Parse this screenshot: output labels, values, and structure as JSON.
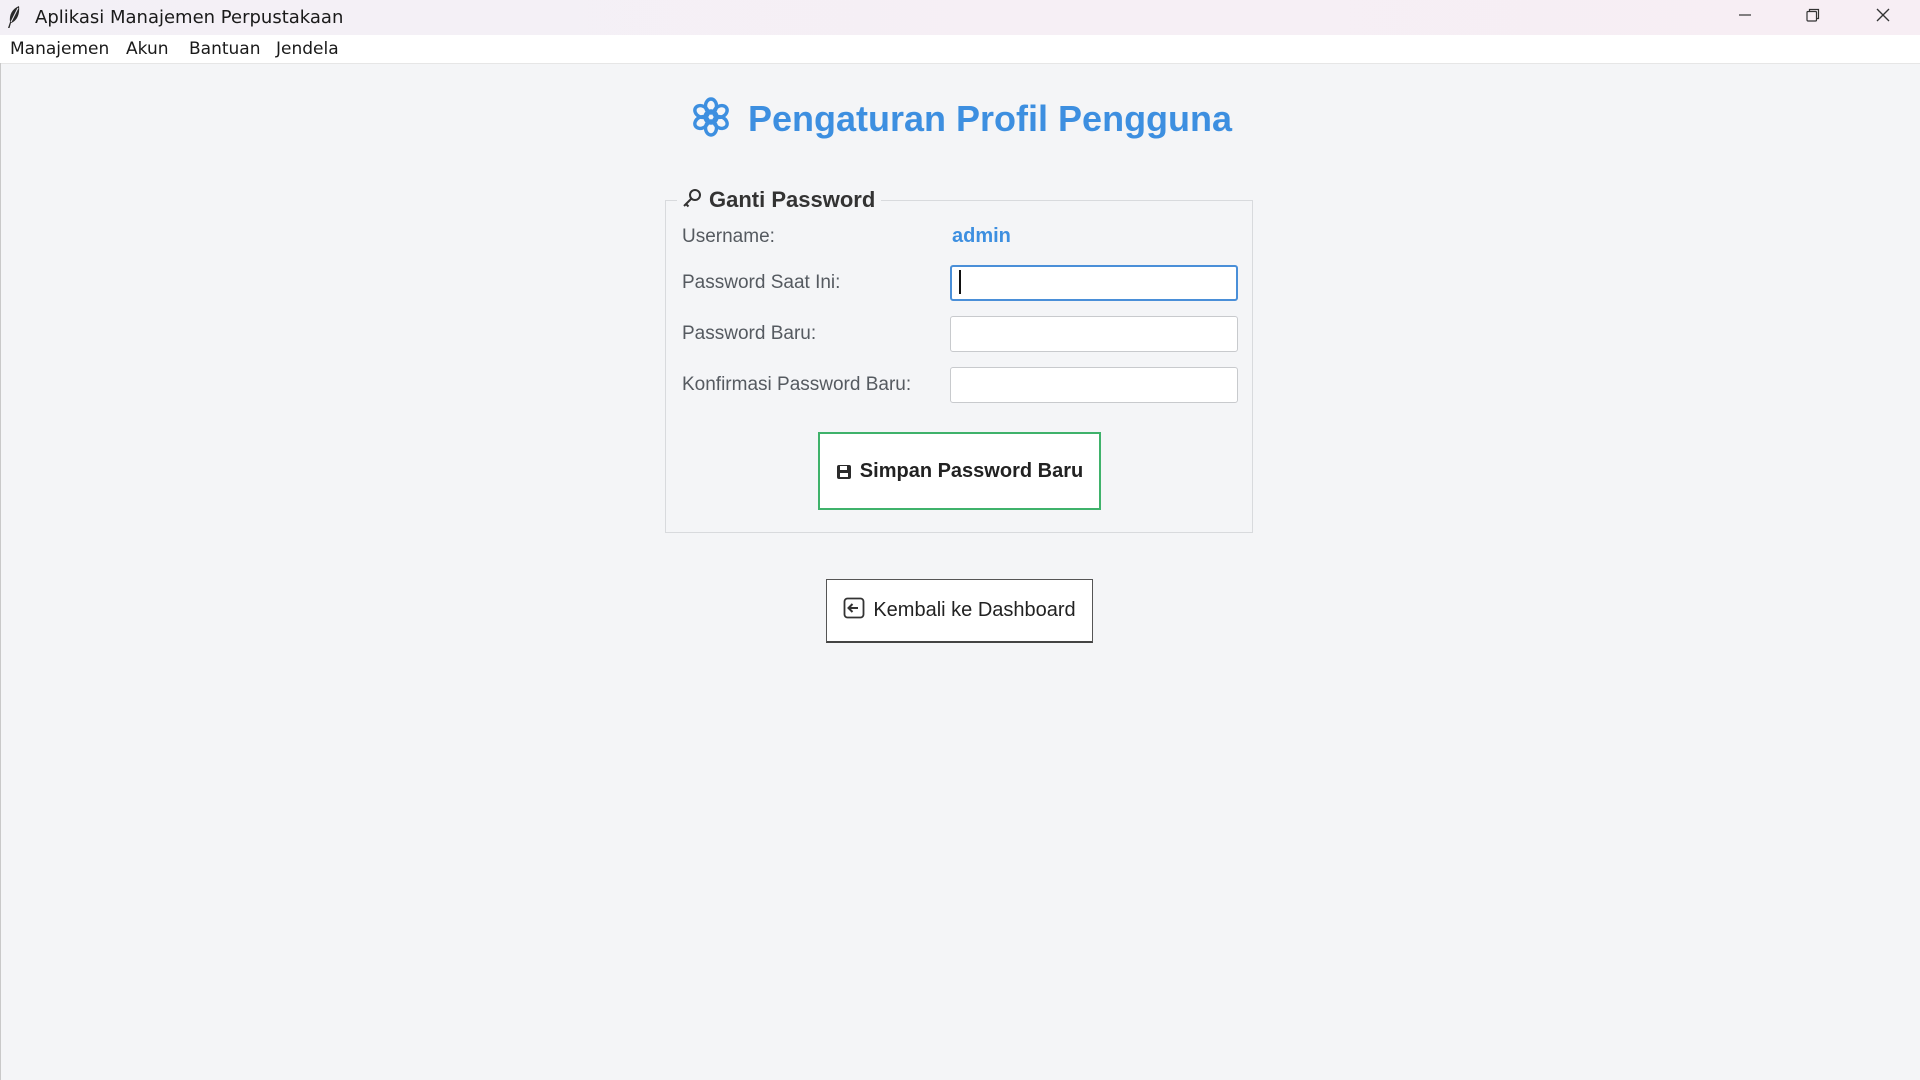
{
  "window": {
    "title": "Aplikasi Manajemen Perpustakaan",
    "app_icon": "feather-icon",
    "controls": {
      "minimize_icon": "minimize-icon",
      "maximize_icon": "restore-icon",
      "close_icon": "close-icon"
    }
  },
  "menubar": {
    "items": [
      {
        "label": "Manajemen"
      },
      {
        "label": "Akun"
      },
      {
        "label": "Bantuan"
      },
      {
        "label": "Jendela"
      }
    ]
  },
  "page": {
    "title": "Pengaturan Profil Pengguna",
    "title_icon": "gear-icon",
    "accent_color": "#3d8fe0"
  },
  "change_password": {
    "legend": "Ganti Password",
    "legend_icon": "key-icon",
    "username_label": "Username:",
    "username_value": "admin",
    "current_password_label": "Password Saat Ini:",
    "current_password_value": "",
    "new_password_label": "Password Baru:",
    "new_password_value": "",
    "confirm_password_label": "Konfirmasi Password Baru:",
    "confirm_password_value": "",
    "save_label": "Simpan Password Baru",
    "save_icon": "floppy-disk-icon",
    "save_border_color": "#3fb26b"
  },
  "navigation": {
    "back_label": "Kembali ke Dashboard",
    "back_icon": "arrow-left-box-icon"
  }
}
